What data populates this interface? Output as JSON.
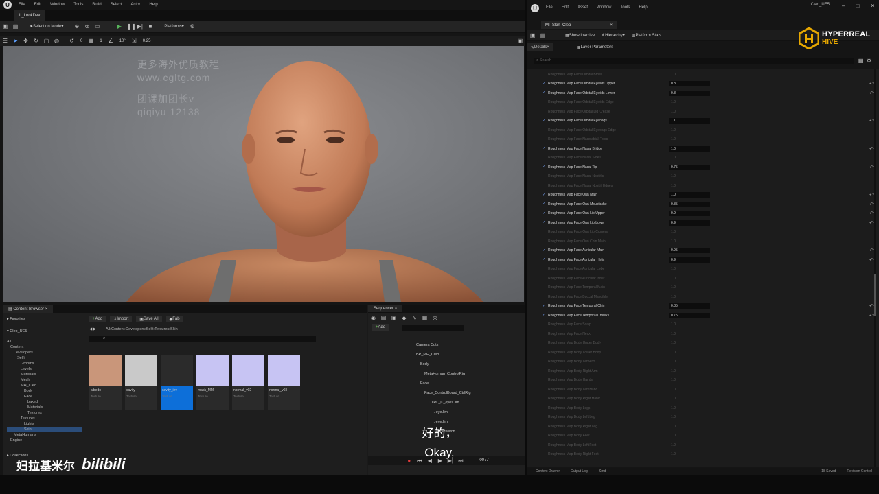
{
  "left": {
    "menu": [
      "File",
      "Edit",
      "Window",
      "Tools",
      "Build",
      "Select",
      "Actor",
      "Help"
    ],
    "level_tab": "L_LookDev",
    "toolbar": {
      "mode": "Selection Mode",
      "platforms": "Platforms"
    },
    "viewport_bar": {
      "grid_value": "10°",
      "scale_value": "0.25",
      "count_a": "0",
      "count_b": "1"
    },
    "watermark": {
      "line1": "更多海外优质教程",
      "line2": "www.cgltg.com",
      "line3": "团课加团长v",
      "line4": "qiqiyu 12138"
    },
    "content_browser": {
      "title": "Content Browser",
      "add": "Add",
      "import": "Import",
      "save_all": "Save All",
      "fab": "Fab",
      "favorites": "Favorites",
      "project": "Cleo_UE5",
      "path": [
        "All",
        "Content",
        "Developers",
        "Selfi",
        "Textures",
        "Skin"
      ],
      "tree": [
        "All",
        "Content",
        "Developers",
        "Selfi",
        "Grooms",
        "Levels",
        "Materials",
        "Mesh",
        "MH_Cleo",
        "Body",
        "Face",
        "baked",
        "Materials",
        "Textures",
        "Textures",
        "Lights",
        "Skin",
        "MetaHumans",
        "Engine"
      ],
      "assets": [
        {
          "name": "albedo",
          "type": "Texture",
          "color": "#c9967a"
        },
        {
          "name": "cavity",
          "type": "Texture",
          "color": "#c9c9c9"
        },
        {
          "name": "cavity_inv",
          "type": "Texture",
          "color": "#2b2b2b"
        },
        {
          "name": "mask_MM",
          "type": "Texture",
          "color": "#c7c4f3"
        },
        {
          "name": "normal_v02",
          "type": "Texture",
          "color": "#c7c4f3"
        },
        {
          "name": "normal_v03",
          "type": "Texture",
          "color": "#c7c4f3"
        }
      ],
      "collections": "Collections",
      "status": "6 items (1 selected)"
    },
    "sequencer": {
      "title": "Sequencer",
      "add": "Add",
      "tracks": [
        "Camera Cuts",
        "BP_MH_Cleo",
        "Body",
        "MetaHuman_ControlRig",
        "Face",
        "Face_ControlBoard_CtrlRig",
        "CTRL_C_eyes.lim",
        "...eye.lim",
        "...eye.lim",
        "...enceSwitch"
      ],
      "frame": "0077"
    },
    "subtitle": {
      "cn": "好的，",
      "en": "Okay,"
    },
    "bilibili": {
      "name": "妇拉基米尔",
      "logo": "bilibili"
    }
  },
  "right": {
    "menu": [
      "File",
      "Edit",
      "Asset",
      "Window",
      "Tools",
      "Help"
    ],
    "title": "Cleo_UE5",
    "tab": "MI_Skin_Cleo",
    "toolbar": {
      "show_inactive": "Show Inactive",
      "hierarchy": "Hierarchy",
      "platform_stats": "Platform Stats"
    },
    "subtabs": {
      "details": "Details",
      "layer_params": "Layer Parameters"
    },
    "search_placeholder": "Search",
    "logo": {
      "line1": "HYPERREAL",
      "line2": "HIVE"
    },
    "params": [
      {
        "name": "Roughness Map Face Orbital Brow",
        "value": "1.0",
        "on": false
      },
      {
        "name": "Roughness Map Face Orbital Eyelids Upper",
        "value": "0.8",
        "on": true
      },
      {
        "name": "Roughness Map Face Orbital Eyelids Lower",
        "value": "0.8",
        "on": true
      },
      {
        "name": "Roughness Map Face Orbital Eyelids Edge",
        "value": "1.0",
        "on": false
      },
      {
        "name": "Roughness Map Face Orbital Lid Crease",
        "value": "1.0",
        "on": false
      },
      {
        "name": "Roughness Map Face Orbital Eyebags",
        "value": "1.1",
        "on": true
      },
      {
        "name": "Roughness Map Face Orbital Eyebags Edge",
        "value": "1.0",
        "on": false
      },
      {
        "name": "Roughness Map Face Nasolabial Folds",
        "value": "1.0",
        "on": false
      },
      {
        "name": "Roughness Map Face Nasal Bridge",
        "value": "1.0",
        "on": true
      },
      {
        "name": "Roughness Map Face Nasal Sides",
        "value": "1.0",
        "on": false
      },
      {
        "name": "Roughness Map Face Nasal Tip",
        "value": "0.75",
        "on": true
      },
      {
        "name": "Roughness Map Face Nasal Nostrils",
        "value": "1.0",
        "on": false
      },
      {
        "name": "Roughness Map Face Nasal Nostril Edges",
        "value": "1.0",
        "on": false
      },
      {
        "name": "Roughness Map Face Oral Main",
        "value": "1.0",
        "on": true
      },
      {
        "name": "Roughness Map Face Oral Moustache",
        "value": "0.85",
        "on": true
      },
      {
        "name": "Roughness Map Face Oral Lip Upper",
        "value": "0.9",
        "on": true
      },
      {
        "name": "Roughness Map Face Oral Lip Lower",
        "value": "0.9",
        "on": true
      },
      {
        "name": "Roughness Map Face Oral Lip Corners",
        "value": "1.0",
        "on": false
      },
      {
        "name": "Roughness Map Face Oral Chin Main",
        "value": "1.0",
        "on": false
      },
      {
        "name": "Roughness Map Face Auricular Main",
        "value": "0.95",
        "on": true
      },
      {
        "name": "Roughness Map Face Auricular Helix",
        "value": "0.9",
        "on": true
      },
      {
        "name": "Roughness Map Face Auricular Lobe",
        "value": "1.0",
        "on": false
      },
      {
        "name": "Roughness Map Face Auricular Inner",
        "value": "1.0",
        "on": false
      },
      {
        "name": "Roughness Map Face Temporal Main",
        "value": "1.0",
        "on": false
      },
      {
        "name": "Roughness Map Face Buccal Mandible",
        "value": "1.0",
        "on": false
      },
      {
        "name": "Roughness Map Face Temporal Chin",
        "value": "0.85",
        "on": true
      },
      {
        "name": "Roughness Map Face Temporal Cheeks",
        "value": "0.75",
        "on": true
      },
      {
        "name": "Roughness Map Face Scalp",
        "value": "1.0",
        "on": false
      },
      {
        "name": "Roughness Map Face Neck",
        "value": "1.0",
        "on": false
      },
      {
        "name": "Roughness Map Body Upper Body",
        "value": "1.0",
        "on": false
      },
      {
        "name": "Roughness Map Body Lower Body",
        "value": "1.0",
        "on": false
      },
      {
        "name": "Roughness Map Body Left Arm",
        "value": "1.0",
        "on": false
      },
      {
        "name": "Roughness Map Body Right Arm",
        "value": "1.0",
        "on": false
      },
      {
        "name": "Roughness Map Body Hands",
        "value": "1.0",
        "on": false
      },
      {
        "name": "Roughness Map Body Left Hand",
        "value": "1.0",
        "on": false
      },
      {
        "name": "Roughness Map Body Right Hand",
        "value": "1.0",
        "on": false
      },
      {
        "name": "Roughness Map Body Legs",
        "value": "1.0",
        "on": false
      },
      {
        "name": "Roughness Map Body Left Leg",
        "value": "1.0",
        "on": false
      },
      {
        "name": "Roughness Map Body Right Leg",
        "value": "1.0",
        "on": false
      },
      {
        "name": "Roughness Map Body Feet",
        "value": "1.0",
        "on": false
      },
      {
        "name": "Roughness Map Body Left Foot",
        "value": "1.0",
        "on": false
      },
      {
        "name": "Roughness Map Body Right Foot",
        "value": "1.0",
        "on": false
      }
    ],
    "bottom": {
      "content_drawer": "Content Drawer",
      "output_log": "Output Log",
      "cmd": "Cmd",
      "saved": "18 Saved",
      "revision": "Revision Control"
    }
  }
}
